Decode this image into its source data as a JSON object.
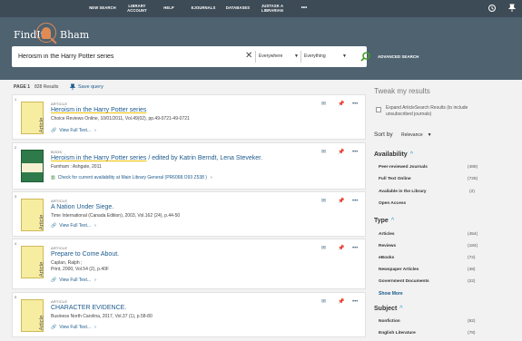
{
  "topnav": [
    {
      "label": "NEW SEARCH"
    },
    {
      "label": "LIBRARY ACCOUNT"
    },
    {
      "label": "HELP"
    },
    {
      "label": "EJOURNALS"
    },
    {
      "label": "DATABASES"
    },
    {
      "label": "JUSTASK A LIBRARIAN"
    },
    {
      "label": "•••"
    }
  ],
  "brand": {
    "left": "FindIt",
    "right": "Bham",
    "accent": "#e08a54"
  },
  "search": {
    "query": "Heroism in the Harry Potter series",
    "scope": "Everywhere",
    "type": "Everything",
    "advanced": "ADVANCED SEARCH"
  },
  "results_meta": {
    "page": "PAGE 1",
    "count": "828 Results",
    "save": "Save query"
  },
  "results": [
    {
      "num": "1",
      "kind": "ARTICLE",
      "thumb": "Article",
      "title": "Heroism in the Harry Potter series",
      "meta": "Choice Reviews Online, 10/01/2011, Vol.49(02), pp.49-0721-49-0721",
      "link": "View Full Text...",
      "highlight": true
    },
    {
      "num": "2",
      "kind": "BOOK",
      "thumb": "",
      "title": "Heroism in the Harry Potter series",
      "title_rest": " / edited by Katrin Berndt, Lena Steveker.",
      "meta": "Farnham : Ashgate, 2011",
      "link": "Check for current availability at Main Library  General (PR6068.O93 Z538 )",
      "highlight": true
    },
    {
      "num": "3",
      "kind": "ARTICLE",
      "thumb": "Article",
      "title": "A Nation Under Siege.",
      "meta": "Time International (Canada Edition), 2003, Vol.162 (24), p.44-50",
      "link": "View Full Text...",
      "highlight": false
    },
    {
      "num": "4",
      "kind": "ARTICLE",
      "thumb": "Article",
      "title": "Prepare to Come About.",
      "meta": "Caplan, Ralph ;",
      "meta2": "Print, 2000, Vol.54 (2), p.40F",
      "link": "View Full Text...",
      "highlight": false
    },
    {
      "num": "5",
      "kind": "ARTICLE",
      "thumb": "Article",
      "title": "CHARACTER EVIDENCE.",
      "meta": "Business North Carolina, 2017, Vol.37 (1), p.58-80",
      "link": "View Full Text...",
      "highlight": false
    }
  ],
  "sidebar": {
    "title": "Tweak my results",
    "expand": "Expand ArticleSearch Results (to include unsubscribed journals)",
    "sort_label": "Sort by",
    "sort_value": "Relevance",
    "availability": {
      "title": "Availability",
      "items": [
        {
          "label": "Peer-reviewed Journals",
          "count": "(489)"
        },
        {
          "label": "Full Text Online",
          "count": "(725)"
        },
        {
          "label": "Available in the Library",
          "count": "(2)"
        },
        {
          "label": "Open Access",
          "count": ""
        }
      ]
    },
    "type": {
      "title": "Type",
      "items": [
        {
          "label": "Articles",
          "count": "(454)"
        },
        {
          "label": "Reviews",
          "count": "(184)"
        },
        {
          "label": "eBooks",
          "count": "(72)"
        },
        {
          "label": "Newspaper Articles",
          "count": "(48)"
        },
        {
          "label": "Government Documents",
          "count": "(22)"
        }
      ],
      "more": "Show More"
    },
    "subject": {
      "title": "Subject",
      "items": [
        {
          "label": "Nonfiction",
          "count": "(82)"
        },
        {
          "label": "English Literature",
          "count": "(78)"
        }
      ]
    }
  }
}
